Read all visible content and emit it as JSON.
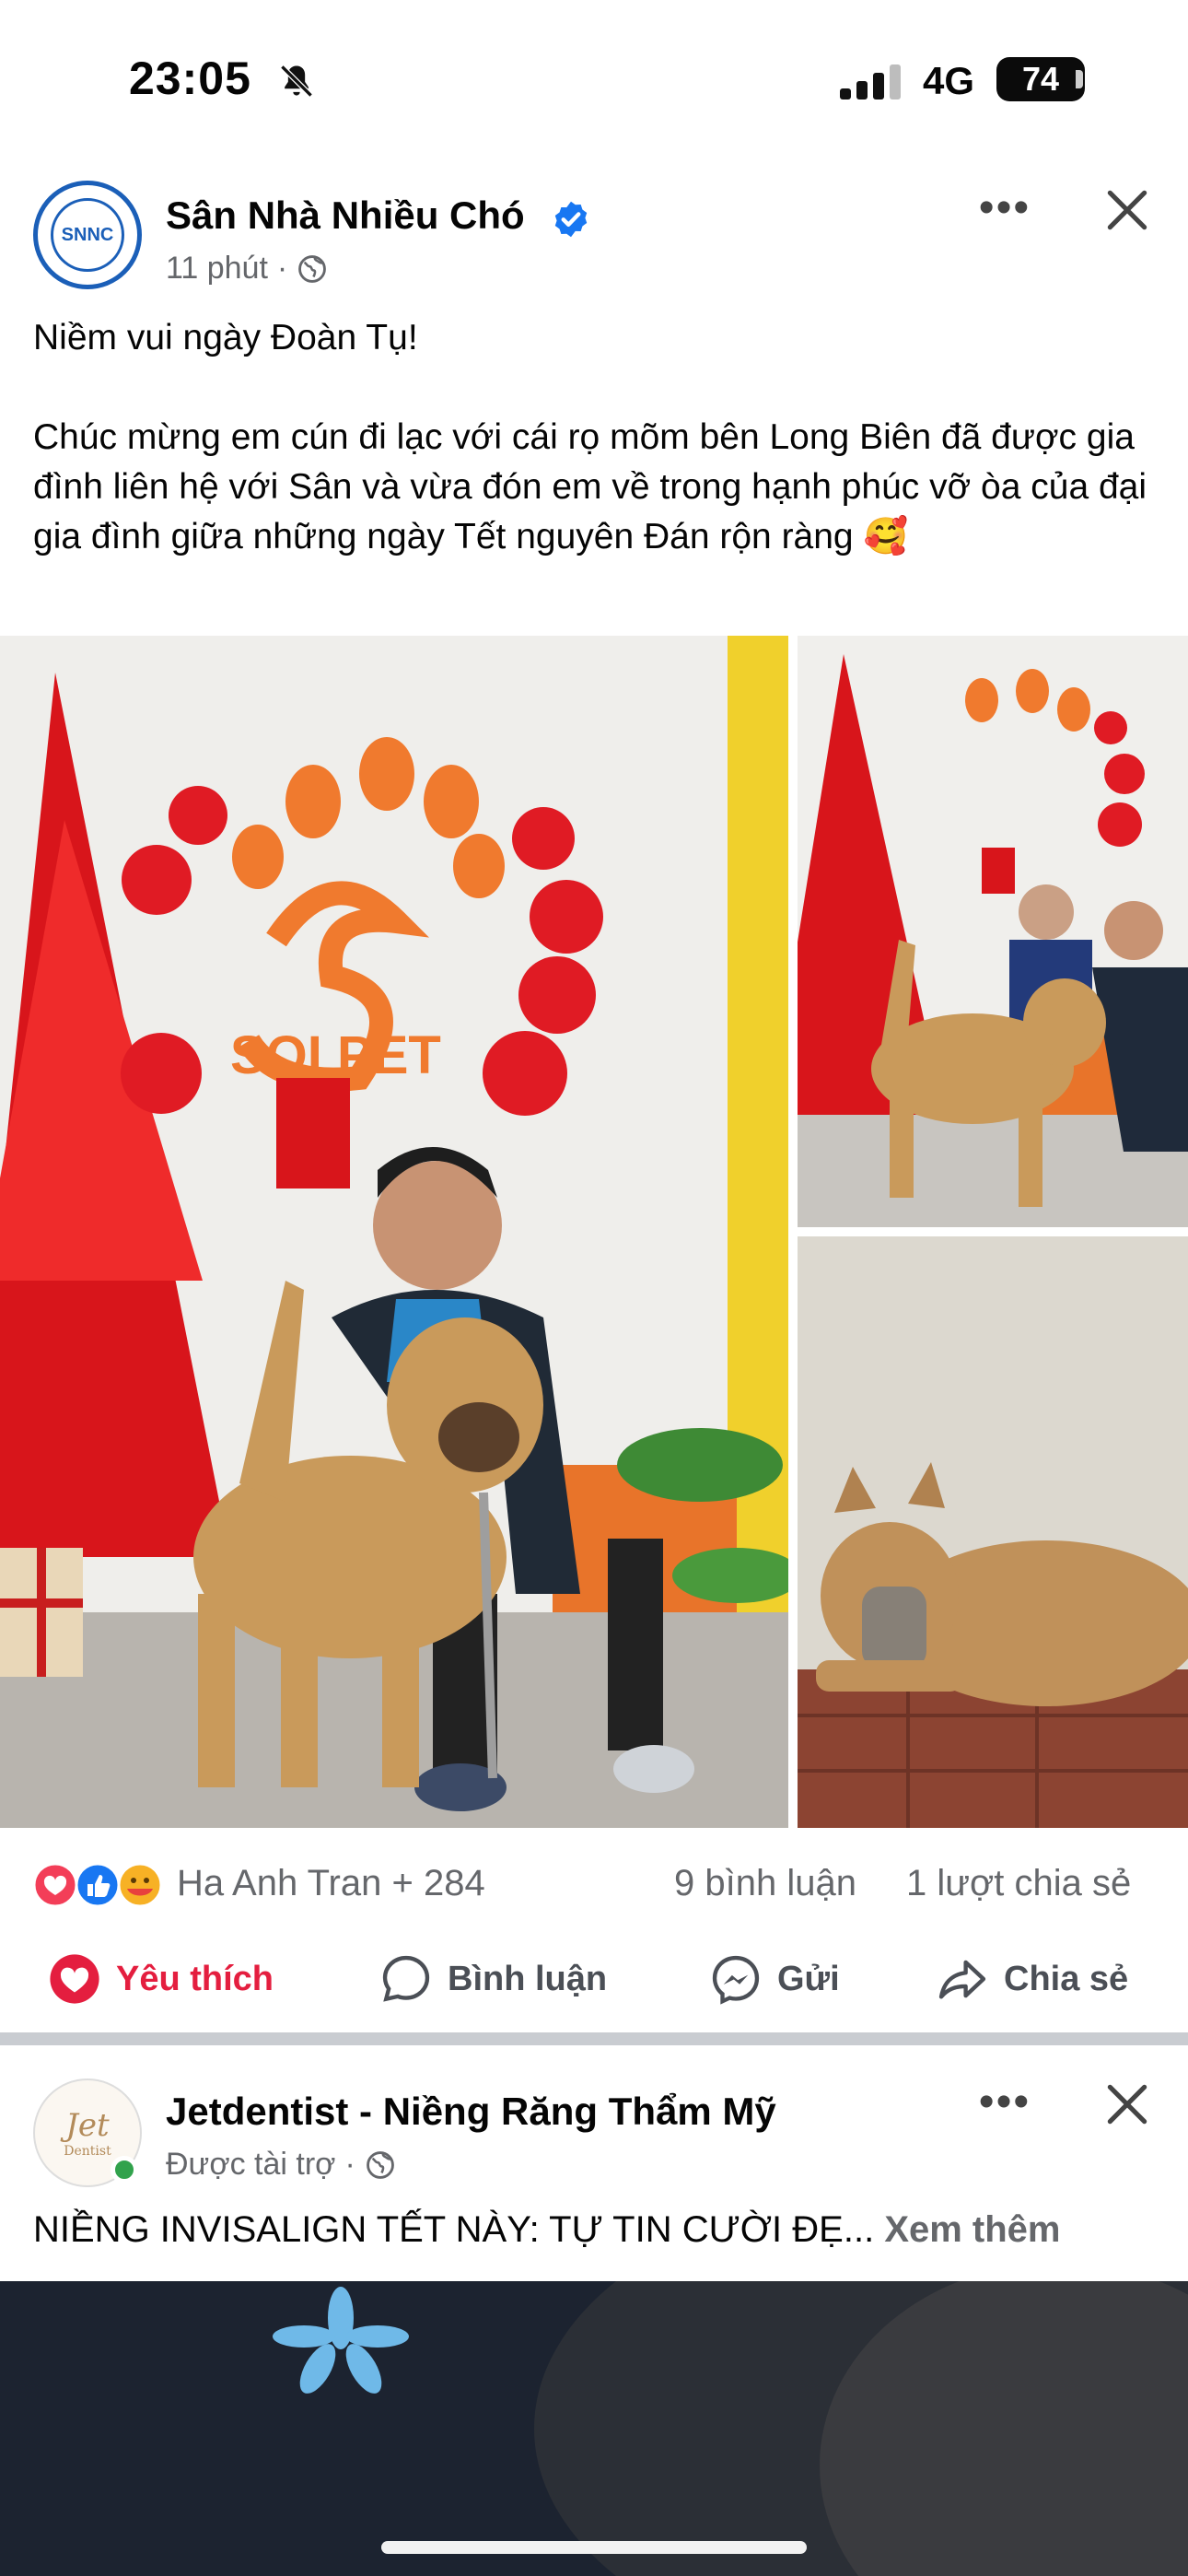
{
  "status_bar": {
    "time": "23:05",
    "network": "4G",
    "battery": "74",
    "icons": [
      "bell-muted-icon",
      "signal-icon",
      "battery-icon"
    ]
  },
  "post": {
    "page_name": "Sân Nhà Nhiều Chó",
    "avatar_text": "SNNC",
    "time_ago": "11 phút",
    "separator": "·",
    "caption": "Niềm vui ngày Đoàn Tụ!\n\nChúc mừng em cún đi lạc với cái rọ mõm bên Long Biên đã được gia đình liên hệ với Sân và vừa đón em về trong hạnh phúc vỡ òa của đại gia đình giữa những ngày Tết nguyên Đán rộn ràng 🥰",
    "photo_sign_text": "SOI PET",
    "reactions": {
      "names": "Ha Anh Tran + 284",
      "comments": "9 bình luận",
      "shares": "1 lượt chia sẻ"
    },
    "actions": {
      "like": "Yêu thích",
      "comment": "Bình luận",
      "send": "Gửi",
      "share": "Chia sẻ"
    }
  },
  "ad_post": {
    "page_name": "Jetdentist - Niềng Răng Thẩm Mỹ",
    "avatar_text": "Jet",
    "avatar_subtext": "Dentist",
    "sponsored": "Được tài trợ",
    "separator": "·",
    "caption": "NIỀNG INVISALIGN TẾT NÀY: TỰ TIN CƯỜI ĐẸ...",
    "see_more": "Xem thêm"
  },
  "colors": {
    "like_red": "#e41e3f",
    "verified_blue": "#1877f2",
    "secondary_text": "#65676b"
  }
}
